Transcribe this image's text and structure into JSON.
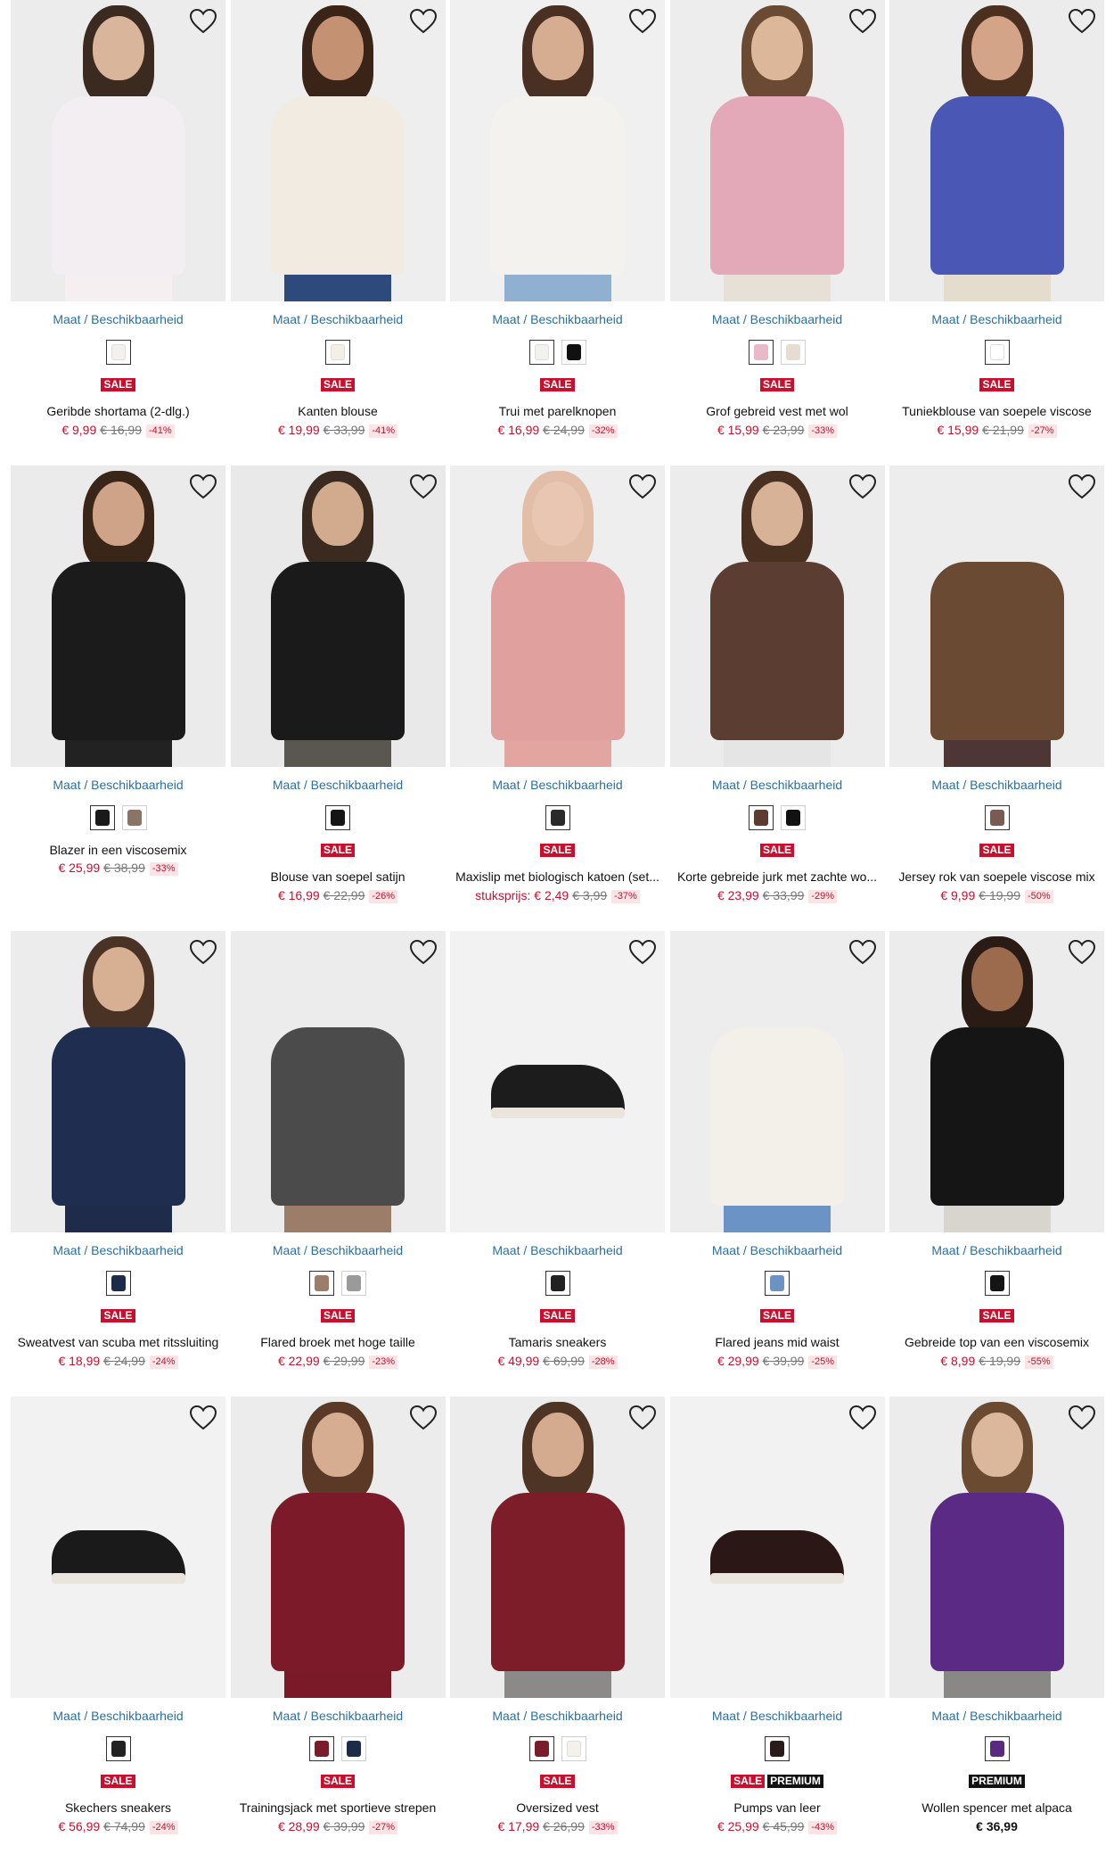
{
  "grid_label": "Product grid",
  "size_link_label": "Maat / Beschikbaarheid",
  "badge_sale": "SALE",
  "badge_premium": "PREMIUM",
  "colors": {
    "sale_red": "#c8102e",
    "link_blue": "#2c6fa0"
  },
  "products": [
    {
      "title": "Geribde shortama (2-dlg.)",
      "price": "€ 9,99",
      "old_price": "€ 16,99",
      "discount": "-41%",
      "sale": true,
      "premium": false,
      "swatches": [
        "#f4f0ee"
      ],
      "photo": {
        "bg": "#ececec",
        "top": "#f3eef2",
        "bottom": "#f5eff1",
        "hair": "#3b2a20",
        "skin": "#d9b59b"
      }
    },
    {
      "title": "Kanten blouse",
      "price": "€ 19,99",
      "old_price": "€ 33,99",
      "discount": "-41%",
      "sale": true,
      "premium": false,
      "swatches": [
        "#f4efe6"
      ],
      "photo": {
        "bg": "#eeeeee",
        "top": "#f1ebe2",
        "bottom": "#2e4a7c",
        "hair": "#3a2418",
        "skin": "#c49272"
      }
    },
    {
      "title": "Trui met parelknopen",
      "price": "€ 16,99",
      "old_price": "€ 24,99",
      "discount": "-32%",
      "sale": true,
      "premium": false,
      "swatches": [
        "#f2f1ee",
        "#111111"
      ],
      "photo": {
        "bg": "#f0f0f0",
        "top": "#f3f2ee",
        "bottom": "#8fb0d0",
        "hair": "#4a3022",
        "skin": "#d6ad90"
      }
    },
    {
      "title": "Grof gebreid vest met wol",
      "price": "€ 15,99",
      "old_price": "€ 23,99",
      "discount": "-33%",
      "sale": true,
      "premium": false,
      "swatches": [
        "#e8b9c6",
        "#e7dcd2"
      ],
      "photo": {
        "bg": "#ededed",
        "top": "#e4a9b8",
        "bottom": "#e6e0d7",
        "hair": "#6b4a33",
        "skin": "#dcb79a"
      }
    },
    {
      "title": "Tuniekblouse van soepele viscose",
      "price": "€ 15,99",
      "old_price": "€ 21,99",
      "discount": "-27%",
      "sale": true,
      "premium": false,
      "swatches": [
        "#ffffff"
      ],
      "photo": {
        "bg": "#ececec",
        "top": "#4a57b5",
        "bottom": "#e4dccd",
        "hair": "#4b3020",
        "skin": "#d3a487"
      }
    },
    {
      "title": "Blazer in een viscosemix",
      "price": "€ 25,99",
      "old_price": "€ 38,99",
      "discount": "-33%",
      "sale": false,
      "premium": false,
      "swatches": [
        "#1a1a1a",
        "#8a7466"
      ],
      "photo": {
        "bg": "#ebebeb",
        "top": "#1b1b1b",
        "bottom": "#222222",
        "hair": "#3a2618",
        "skin": "#cfa387"
      }
    },
    {
      "title": "Blouse van soepel satijn",
      "price": "€ 16,99",
      "old_price": "€ 22,99",
      "discount": "-26%",
      "sale": true,
      "premium": false,
      "swatches": [
        "#151515"
      ],
      "photo": {
        "bg": "#e9e9e9",
        "top": "#1a1a1a",
        "bottom": "#5a5650",
        "hair": "#3b2a1f",
        "skin": "#d2ab8f"
      }
    },
    {
      "title": "Maxislip met biologisch katoen (set...",
      "price": "stuksprijs: € 2,49",
      "old_price": "€ 3,99",
      "discount": "-37%",
      "sale": true,
      "premium": false,
      "swatches": [
        "#2a2a2a"
      ],
      "photo": {
        "bg": "#eeeeee",
        "top": "#e0a09d",
        "bottom": "#e3a5a0",
        "hair": "#e2bda8",
        "skin": "#e8c6b2"
      }
    },
    {
      "title": "Korte gebreide jurk met zachte wo...",
      "price": "€ 23,99",
      "old_price": "€ 33,99",
      "discount": "-29%",
      "sale": true,
      "premium": false,
      "swatches": [
        "#5a3c30",
        "#121212"
      ],
      "photo": {
        "bg": "#ececec",
        "top": "#5b3d31",
        "bottom": "#e5e5e5",
        "hair": "#4a3020",
        "skin": "#d8b296"
      }
    },
    {
      "title": "Jersey rok van soepele viscose mix",
      "price": "€ 9,99",
      "old_price": "€ 19,99",
      "discount": "-50%",
      "sale": true,
      "premium": false,
      "swatches": [
        "#7a5b54"
      ],
      "photo": {
        "bg": "#ededed",
        "top": "#6a4a32",
        "bottom": "#4e3636",
        "hair": "#ededed",
        "skin": "#ededed"
      }
    },
    {
      "title": "Sweatvest van scuba met ritssluiting",
      "price": "€ 18,99",
      "old_price": "€ 24,99",
      "discount": "-24%",
      "sale": true,
      "premium": false,
      "swatches": [
        "#1d2b4a"
      ],
      "photo": {
        "bg": "#ececec",
        "top": "#1f2e50",
        "bottom": "#1e2b4b",
        "hair": "#4a3324",
        "skin": "#d7af93"
      }
    },
    {
      "title": "Flared broek met hoge taille",
      "price": "€ 22,99",
      "old_price": "€ 29,99",
      "discount": "-23%",
      "sale": true,
      "premium": false,
      "swatches": [
        "#9c7d67",
        "#9a9a9a"
      ],
      "photo": {
        "bg": "#ececec",
        "top": "#4b4b4b",
        "bottom": "#9b7d6a",
        "hair": "#ececec",
        "skin": "#ececec"
      }
    },
    {
      "title": "Tamaris sneakers",
      "price": "€ 49,99",
      "old_price": "€ 69,99",
      "discount": "-28%",
      "sale": true,
      "premium": false,
      "swatches": [
        "#222222"
      ],
      "shoe": "#1c1c1c",
      "photo": {
        "bg": "#f2f2f2"
      }
    },
    {
      "title": "Flared jeans mid waist",
      "price": "€ 29,99",
      "old_price": "€ 39,99",
      "discount": "-25%",
      "sale": true,
      "premium": false,
      "swatches": [
        "#6d93c4"
      ],
      "photo": {
        "bg": "#ededed",
        "top": "#f3f0ea",
        "bottom": "#6c93c5",
        "hair": "#ededed",
        "skin": "#ededed"
      }
    },
    {
      "title": "Gebreide top van een viscosemix",
      "price": "€ 8,99",
      "old_price": "€ 19,99",
      "discount": "-55%",
      "sale": true,
      "premium": false,
      "swatches": [
        "#141414"
      ],
      "photo": {
        "bg": "#ececec",
        "top": "#151515",
        "bottom": "#d8d4ce",
        "hair": "#2a1b14",
        "skin": "#9c6b4e"
      }
    },
    {
      "title": "Skechers sneakers",
      "price": "€ 56,99",
      "old_price": "€ 74,99",
      "discount": "-24%",
      "sale": true,
      "premium": false,
      "swatches": [
        "#222222"
      ],
      "shoe": "#1a1a1a",
      "photo": {
        "bg": "#f2f2f2"
      }
    },
    {
      "title": "Trainingsjack met sportieve strepen",
      "price": "€ 28,99",
      "old_price": "€ 39,99",
      "discount": "-27%",
      "sale": true,
      "premium": false,
      "swatches": [
        "#7b1c2a",
        "#1d2b4a"
      ],
      "photo": {
        "bg": "#ececec",
        "top": "#7d1a29",
        "bottom": "#7a1a28",
        "hair": "#5a3a26",
        "skin": "#d6ad91"
      }
    },
    {
      "title": "Oversized vest",
      "price": "€ 17,99",
      "old_price": "€ 26,99",
      "discount": "-33%",
      "sale": true,
      "premium": false,
      "swatches": [
        "#7b1c2a",
        "#f4f1ec"
      ],
      "photo": {
        "bg": "#ececec",
        "top": "#7e1d2a",
        "bottom": "#8c8a88",
        "hair": "#4e3424",
        "skin": "#d5ab8f"
      }
    },
    {
      "title": "Pumps van leer",
      "price": "€ 25,99",
      "old_price": "€ 45,99",
      "discount": "-43%",
      "sale": true,
      "premium": true,
      "swatches": [
        "#2a1a1a"
      ],
      "shoe": "#2b1716",
      "photo": {
        "bg": "#f2f2f2"
      }
    },
    {
      "title": "Wollen spencer met alpaca",
      "price": "€ 36,99",
      "old_price": "",
      "discount": "",
      "sale": false,
      "premium": true,
      "swatches": [
        "#5a2a80"
      ],
      "photo": {
        "bg": "#ececec",
        "top": "#5b2a85",
        "bottom": "#8a8886",
        "hair": "#6a4a30",
        "skin": "#dbb89c"
      }
    }
  ]
}
